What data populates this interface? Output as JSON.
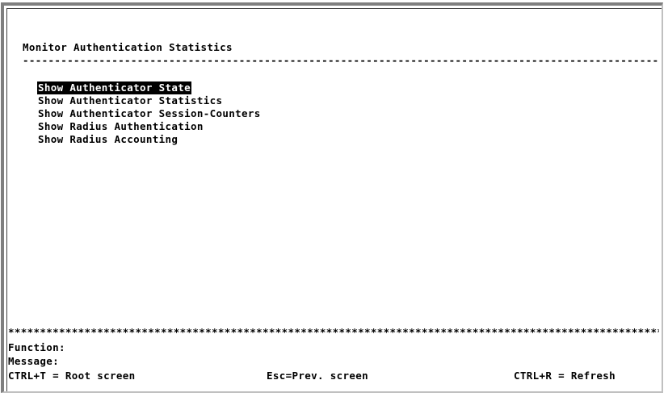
{
  "screen": {
    "title": "Monitor Authentication Statistics",
    "separator": "-----------------------------------------------------------------------------------------------------------",
    "star_separator": "************************************************************************************************************"
  },
  "menu": {
    "items": [
      {
        "label": "Show Authenticator State",
        "selected": true
      },
      {
        "label": "Show Authenticator Statistics",
        "selected": false
      },
      {
        "label": "Show Authenticator Session-Counters",
        "selected": false
      },
      {
        "label": "Show Radius Authentication",
        "selected": false
      },
      {
        "label": "Show Radius Accounting",
        "selected": false
      }
    ]
  },
  "footer": {
    "function_label": "Function:",
    "message_label": "Message:",
    "hints": {
      "root": "CTRL+T = Root screen",
      "prev": "Esc=Prev. screen",
      "refresh": "CTRL+R = Refresh"
    }
  },
  "colors": {
    "background": "#ffffff",
    "text": "#000000",
    "highlight_bg": "#000000",
    "highlight_text": "#ffffff",
    "frame": "#7f7f7f"
  }
}
